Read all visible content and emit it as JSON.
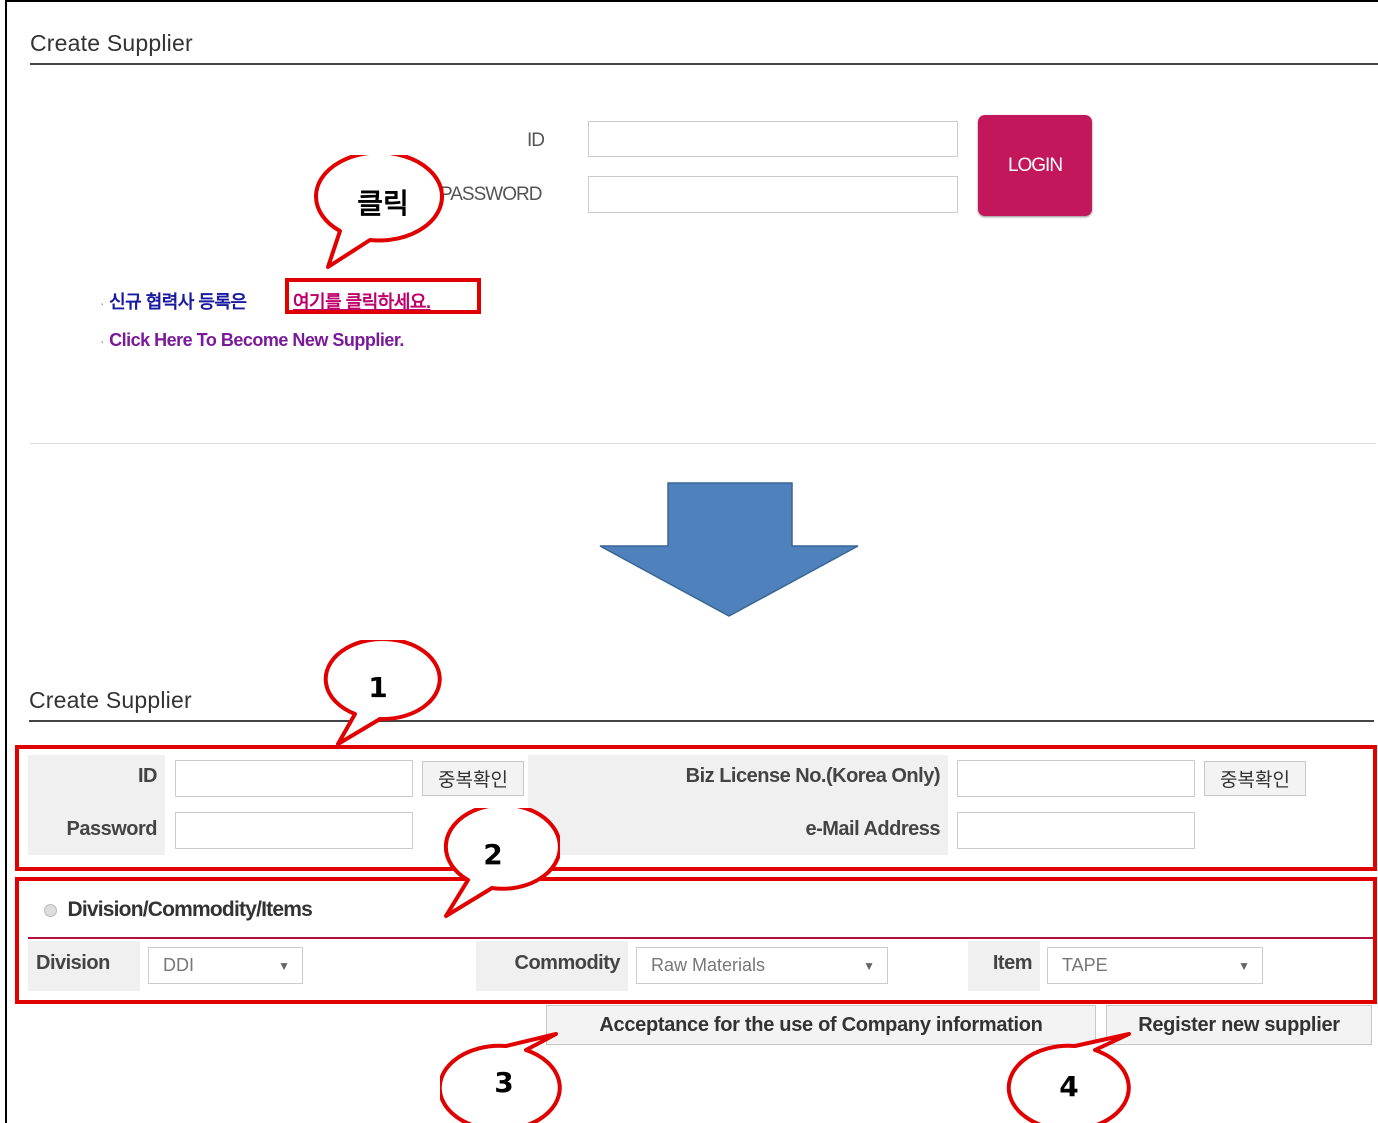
{
  "top_section": {
    "title": "Create Supplier",
    "id_label": "ID",
    "password_label": "PASSWORD",
    "id_value": "",
    "password_value": "",
    "login_label": "LOGIN",
    "link_kr_prefix": "신규 협력사 등록은",
    "link_kr_action": "여기를 클릭하세요.",
    "link_en": "Click Here To Become New Supplier."
  },
  "callouts": {
    "click": "클릭",
    "c1": "1",
    "c2": "2",
    "c3": "3",
    "c4": "4"
  },
  "bottom_section": {
    "title": "Create Supplier",
    "form": {
      "id_label": "ID",
      "id_value": "",
      "check_dup_label": "중복확인",
      "password_label": "Password",
      "password_value": "",
      "biz_label": "Biz License No.(Korea Only)",
      "biz_value": "",
      "biz_check_label": "중복확인",
      "email_label": "e-Mail Address",
      "email_value": ""
    },
    "division_section": {
      "heading": "Division/Commodity/Items",
      "division_label": "Division",
      "division_value": "DDI",
      "commodity_label": "Commodity",
      "commodity_value": "Raw Materials",
      "item_label": "Item",
      "item_value": "TAPE"
    },
    "buttons": {
      "acceptance": "Acceptance for the use of Company information",
      "register": "Register new supplier"
    }
  },
  "colors": {
    "login_bg": "#c2185b",
    "highlight_red": "#e00000",
    "arrow_blue": "#4f81bd",
    "divider_crimson": "#b0103a"
  },
  "icons": {
    "arrow": "down-arrow-icon",
    "bullet": "bullet-dot-icon",
    "select_arrow": "chevron-down-icon"
  }
}
